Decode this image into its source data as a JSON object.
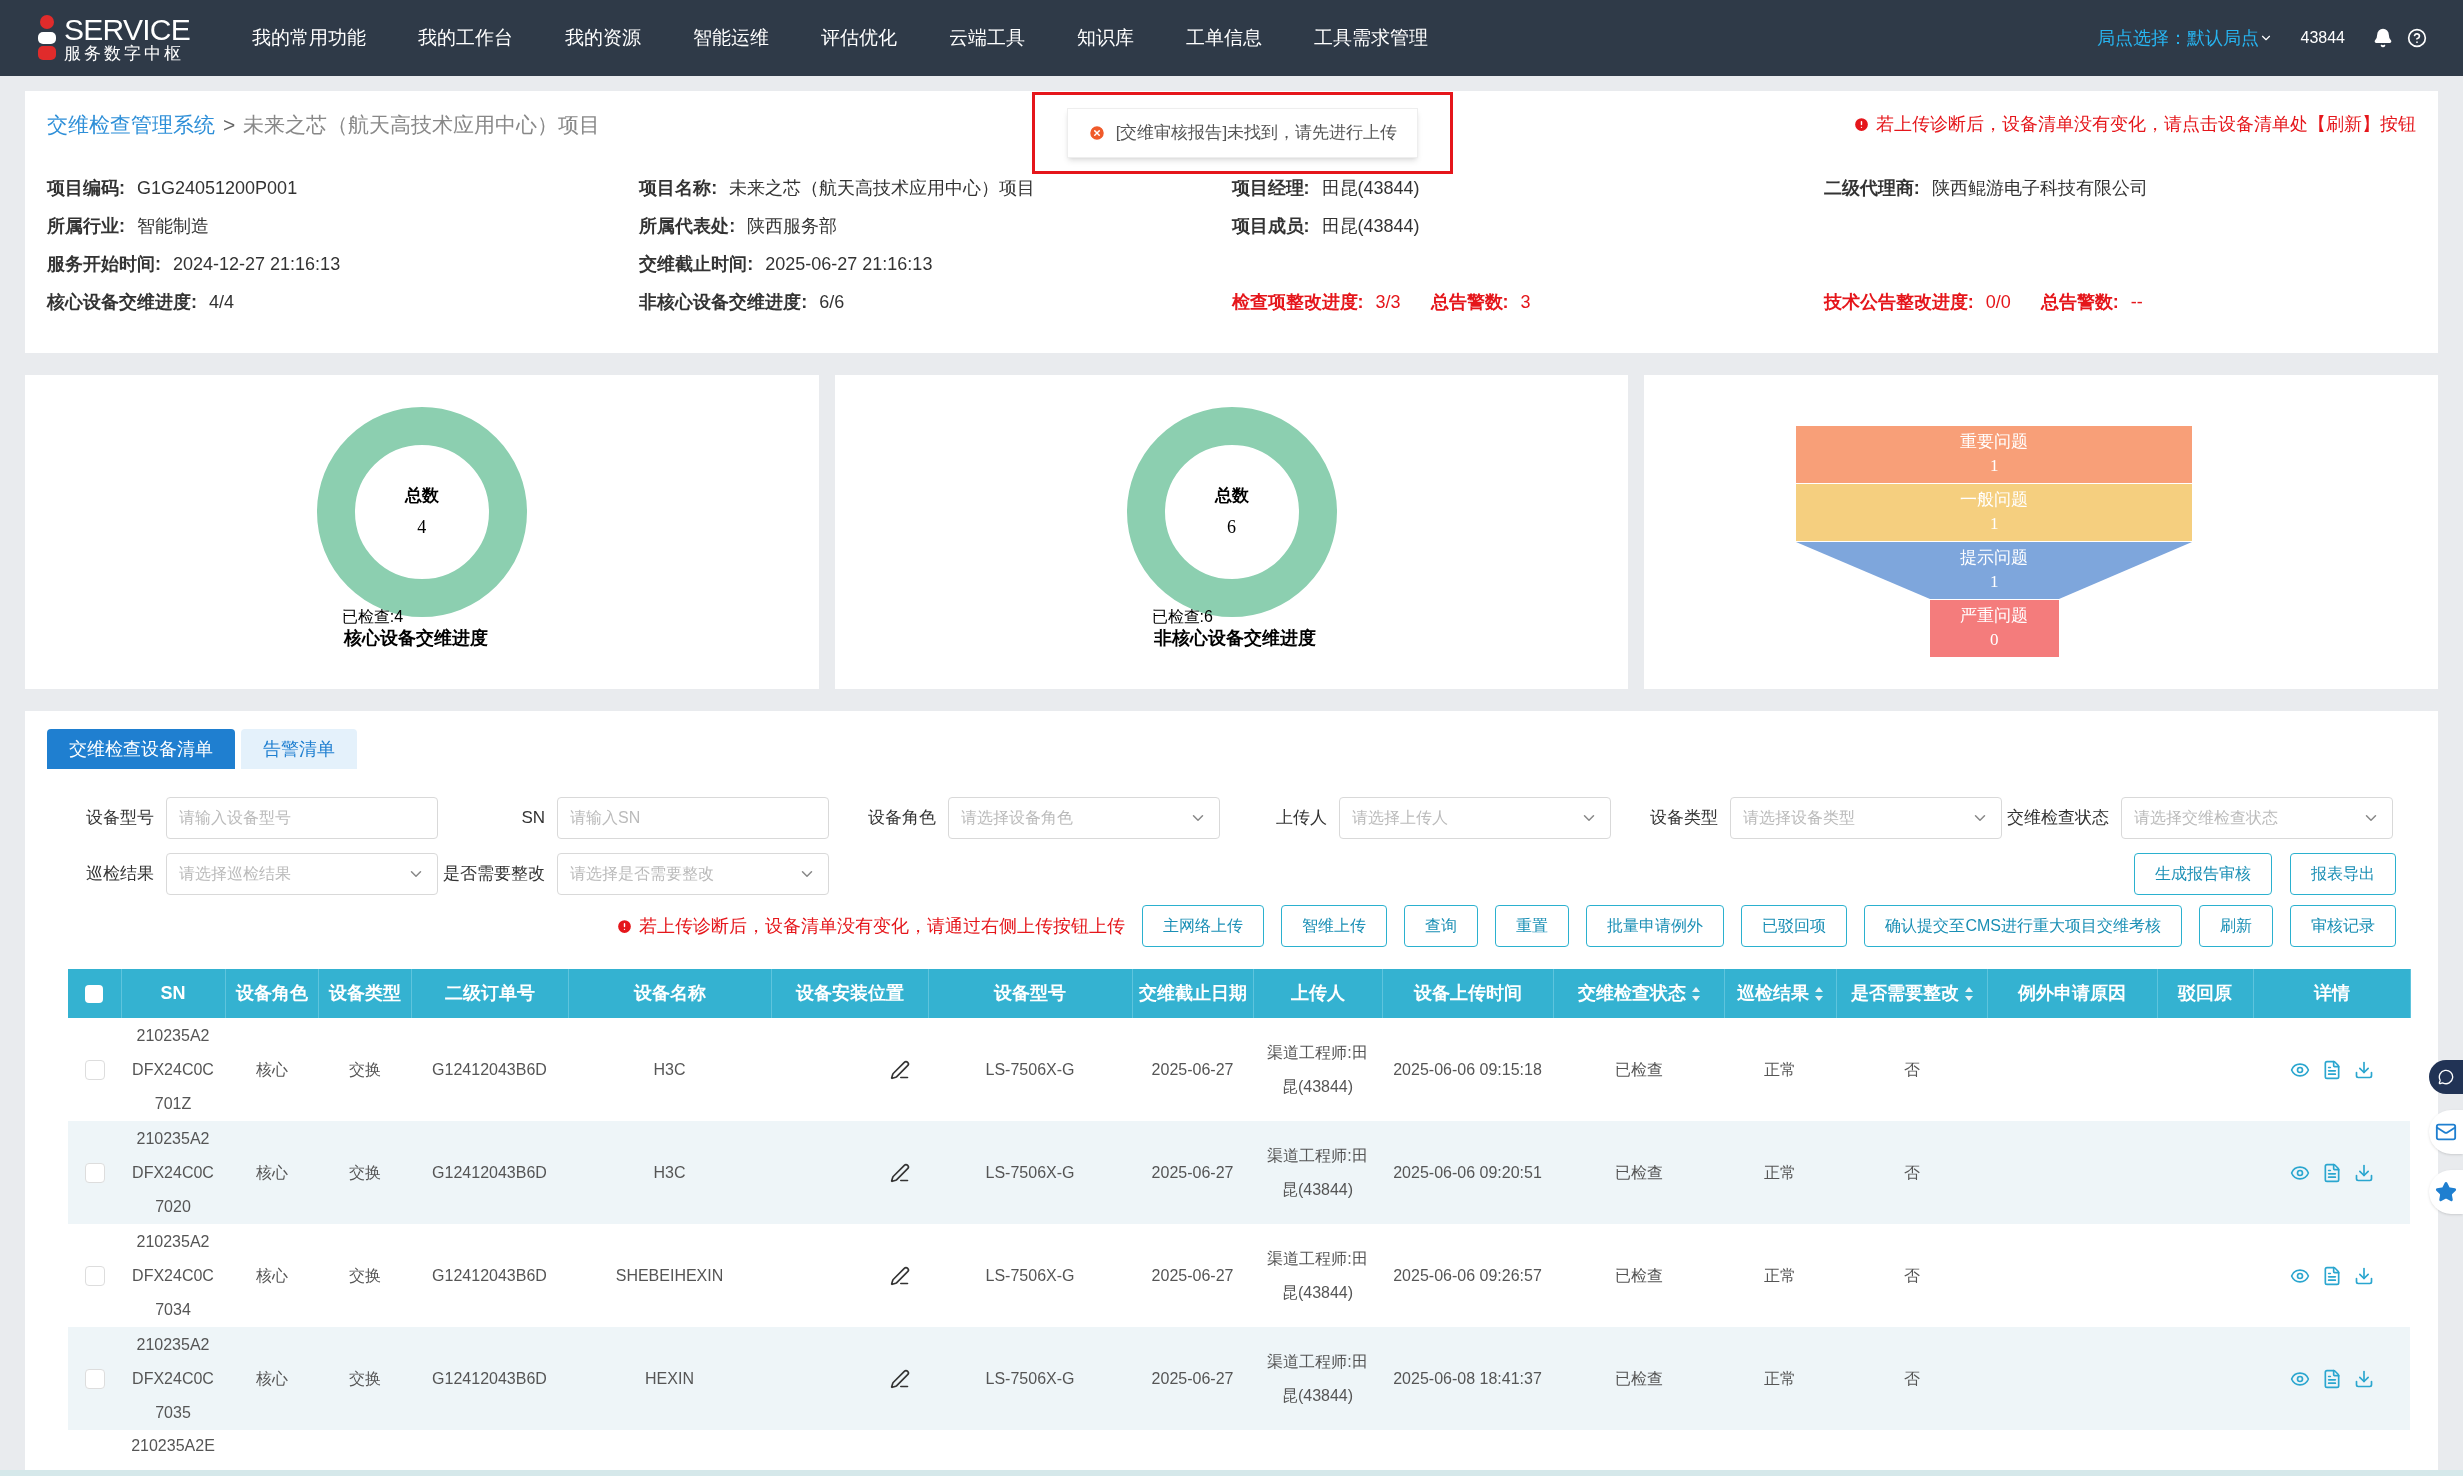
{
  "nav": {
    "logo_title": "SERVICE",
    "logo_subtitle": "服务数字中枢",
    "items": [
      {
        "label": "我的常用功能"
      },
      {
        "label": "我的工作台"
      },
      {
        "label": "我的资源"
      },
      {
        "label": "智能运维"
      },
      {
        "label": "评估优化"
      },
      {
        "label": "云端工具"
      },
      {
        "label": "知识库"
      },
      {
        "label": "工单信息"
      },
      {
        "label": "工具需求管理"
      }
    ],
    "site_select": "局点选择：默认局点",
    "user": "43844"
  },
  "toast": {
    "message": "[交维审核报告]未找到，请先进行上传"
  },
  "breadcrumb": {
    "link": "交维检查管理系统",
    "separator": ">",
    "current": "未来之芯（航天高技术应用中心）项目"
  },
  "notice": "若上传诊断后，设备清单没有变化，请点击设备清单处【刷新】按钮",
  "info_rows": [
    [
      {
        "pairs": [
          {
            "label": "项目编码:",
            "value": "G1G24051200P001",
            "alert": false
          }
        ]
      },
      {
        "pairs": [
          {
            "label": "项目名称:",
            "value": "未来之芯（航天高技术应用中心）项目",
            "alert": false
          }
        ]
      },
      {
        "pairs": [
          {
            "label": "项目经理:",
            "value": "田昆(43844)",
            "alert": false
          }
        ]
      },
      {
        "pairs": [
          {
            "label": "二级代理商:",
            "value": "陕西鲲游电子科技有限公司",
            "alert": false
          }
        ]
      }
    ],
    [
      {
        "pairs": [
          {
            "label": "所属行业:",
            "value": "智能制造",
            "alert": false
          }
        ]
      },
      {
        "pairs": [
          {
            "label": "所属代表处:",
            "value": "陕西服务部",
            "alert": false
          }
        ]
      },
      {
        "pairs": [
          {
            "label": "项目成员:",
            "value": "田昆(43844)",
            "alert": false
          }
        ]
      },
      {}
    ],
    [
      {
        "pairs": [
          {
            "label": "服务开始时间:",
            "value": "2024-12-27 21:16:13",
            "alert": false
          }
        ]
      },
      {
        "pairs": [
          {
            "label": "交维截止时间:",
            "value": "2025-06-27 21:16:13",
            "alert": false
          }
        ]
      },
      {},
      {}
    ],
    [
      {
        "pairs": [
          {
            "label": "核心设备交维进度:",
            "value": "4/4",
            "alert": false
          }
        ]
      },
      {
        "pairs": [
          {
            "label": "非核心设备交维进度:",
            "value": "6/6",
            "alert": false
          }
        ]
      },
      {
        "pairs": [
          {
            "label": "检查项整改进度:",
            "value": "3/3",
            "alert": true
          },
          {
            "label": "总告警数:",
            "value": "3",
            "alert": true
          }
        ]
      },
      {
        "pairs": [
          {
            "label": "技术公告整改进度:",
            "value": "0/0",
            "alert": true
          },
          {
            "label": "总告警数:",
            "value": "--",
            "alert": true
          }
        ]
      }
    ]
  ],
  "donuts": [
    {
      "center_label": "总数",
      "total": "4",
      "checked": "已检查:4",
      "title": "核心设备交维进度"
    },
    {
      "center_label": "总数",
      "total": "6",
      "checked": "已检查:6",
      "title": "非核心设备交维进度"
    }
  ],
  "funnel": [
    {
      "label": "重要问题",
      "value": "1",
      "color": "#f89f78"
    },
    {
      "label": "一般问题",
      "value": "1",
      "color": "#f5cf7f"
    },
    {
      "label": "提示问题",
      "value": "1",
      "color": "#7ea6dc"
    },
    {
      "label": "严重问题",
      "value": "0",
      "color": "#f47c7c"
    }
  ],
  "tabs": [
    {
      "label": "交维检查设备清单",
      "selected": true
    },
    {
      "label": "告警清单",
      "selected": false
    }
  ],
  "filters_row1": [
    {
      "label": "设备型号",
      "kind": "input",
      "placeholder": "请输入设备型号"
    },
    {
      "label": "SN",
      "kind": "input",
      "placeholder": "请输入SN"
    },
    {
      "label": "设备角色",
      "kind": "select",
      "placeholder": "请选择设备角色"
    },
    {
      "label": "上传人",
      "kind": "select",
      "placeholder": "请选择上传人"
    },
    {
      "label": "设备类型",
      "kind": "select",
      "placeholder": "请选择设备类型"
    },
    {
      "label": "交维检查状态",
      "kind": "select",
      "placeholder": "请选择交维检查状态"
    }
  ],
  "filters_row2": [
    {
      "label": "巡检结果",
      "kind": "select",
      "placeholder": "请选择巡检结果"
    },
    {
      "label": "是否需要整改",
      "kind": "select",
      "placeholder": "请选择是否需要整改"
    }
  ],
  "row2_buttons": [
    "生成报告审核",
    "报表导出"
  ],
  "upload_hint": "若上传诊断后，设备清单没有变化，请通过右侧上传按钮上传",
  "action_buttons": [
    "主网络上传",
    "智维上传",
    "查询",
    "重置",
    "批量申请例外",
    "已驳回项",
    "确认提交至CMS进行重大项目交维考核",
    "刷新",
    "审核记录"
  ],
  "table": {
    "columns": [
      {
        "label": "SN",
        "sortable": false
      },
      {
        "label": "设备角色",
        "sortable": false
      },
      {
        "label": "设备类型",
        "sortable": false
      },
      {
        "label": "二级订单号",
        "sortable": false
      },
      {
        "label": "设备名称",
        "sortable": false
      },
      {
        "label": "设备安装位置",
        "sortable": false
      },
      {
        "label": "设备型号",
        "sortable": false
      },
      {
        "label": "交维截止日期",
        "sortable": false
      },
      {
        "label": "上传人",
        "sortable": false
      },
      {
        "label": "设备上传时间",
        "sortable": false
      },
      {
        "label": "交维检查状态",
        "sortable": true
      },
      {
        "label": "巡检结果",
        "sortable": true
      },
      {
        "label": "是否需要整改",
        "sortable": true
      },
      {
        "label": "例外申请原因",
        "sortable": false
      },
      {
        "label": "驳回原",
        "sortable": false
      },
      {
        "label": "详情",
        "sortable": false
      }
    ],
    "select_all_checked": false,
    "rows": [
      {
        "checked": false,
        "sn": [
          "210235A2",
          "DFX24C0C",
          "701Z"
        ],
        "role": "核心",
        "type": "交换",
        "order": "G12412043B6D",
        "name": "H3C",
        "model": "LS-7506X-G",
        "deadline": "2025-06-27",
        "uploader": [
          "渠道工程师:田",
          "昆(43844)"
        ],
        "upload_time": "2025-06-06 09:15:18",
        "status": "已检查",
        "result": "正常",
        "rectify": "否"
      },
      {
        "checked": false,
        "sn": [
          "210235A2",
          "DFX24C0C",
          "7020"
        ],
        "role": "核心",
        "type": "交换",
        "order": "G12412043B6D",
        "name": "H3C",
        "model": "LS-7506X-G",
        "deadline": "2025-06-27",
        "uploader": [
          "渠道工程师:田",
          "昆(43844)"
        ],
        "upload_time": "2025-06-06 09:20:51",
        "status": "已检查",
        "result": "正常",
        "rectify": "否"
      },
      {
        "checked": false,
        "sn": [
          "210235A2",
          "DFX24C0C",
          "7034"
        ],
        "role": "核心",
        "type": "交换",
        "order": "G12412043B6D",
        "name": "SHEBEIHEXIN",
        "model": "LS-7506X-G",
        "deadline": "2025-06-27",
        "uploader": [
          "渠道工程师:田",
          "昆(43844)"
        ],
        "upload_time": "2025-06-06 09:26:57",
        "status": "已检查",
        "result": "正常",
        "rectify": "否"
      },
      {
        "checked": false,
        "sn": [
          "210235A2",
          "DFX24C0C",
          "7035"
        ],
        "role": "核心",
        "type": "交换",
        "order": "G12412043B6D",
        "name": "HEXIN",
        "model": "LS-7506X-G",
        "deadline": "2025-06-27",
        "uploader": [
          "渠道工程师:田",
          "昆(43844)"
        ],
        "upload_time": "2025-06-08 18:41:37",
        "status": "已检查",
        "result": "正常",
        "rectify": "否"
      }
    ],
    "partial_row_sn": "210235A2E"
  }
}
